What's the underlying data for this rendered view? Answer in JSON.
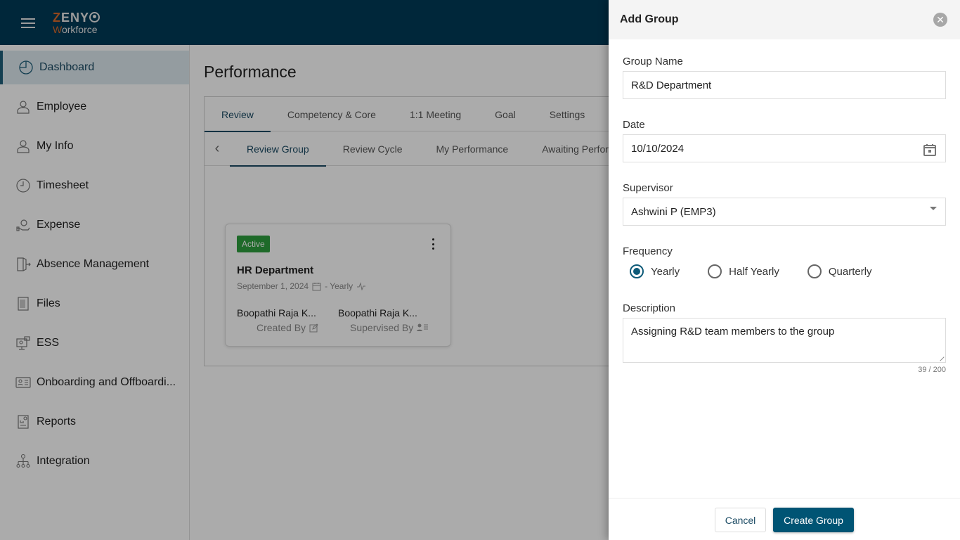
{
  "header": {
    "menu_icon": "hamburger-icon",
    "logo_line1": "ZENY",
    "logo_line2": "Workforce"
  },
  "sidebar": {
    "items": [
      {
        "label": "Dashboard",
        "icon": "pie-chart-icon",
        "active": true
      },
      {
        "label": "Employee",
        "icon": "person-icon"
      },
      {
        "label": "My Info",
        "icon": "person-icon"
      },
      {
        "label": "Timesheet",
        "icon": "clock-icon"
      },
      {
        "label": "Expense",
        "icon": "money-hand-icon"
      },
      {
        "label": "Absence Management",
        "icon": "door-exit-icon"
      },
      {
        "label": "Files",
        "icon": "files-icon"
      },
      {
        "label": "ESS",
        "icon": "monitor-person-icon"
      },
      {
        "label": "Onboarding and Offboardi...",
        "icon": "id-card-icon"
      },
      {
        "label": "Reports",
        "icon": "report-icon"
      },
      {
        "label": "Integration",
        "icon": "hierarchy-icon"
      }
    ]
  },
  "main": {
    "title": "Performance",
    "tabs": [
      {
        "label": "Review",
        "active": true
      },
      {
        "label": "Competency & Core"
      },
      {
        "label": "1:1 Meeting"
      },
      {
        "label": "Goal"
      },
      {
        "label": "Settings"
      }
    ],
    "subtabs": [
      {
        "label": "Review Group",
        "active": true
      },
      {
        "label": "Review Cycle"
      },
      {
        "label": "My Performance"
      },
      {
        "label": "Awaiting Perform"
      }
    ],
    "card": {
      "status": "Active",
      "status_color": "#2e9e3e",
      "title": "HR Department",
      "date": "September 1, 2024",
      "frequency": "- Yearly",
      "created_by_name": "Boopathi Raja K...",
      "created_by_label": "Created By",
      "supervised_by_name": "Boopathi Raja K...",
      "supervised_by_label": "Supervised By"
    }
  },
  "drawer": {
    "title": "Add Group",
    "group_name_label": "Group Name",
    "group_name_value": "R&D Department",
    "date_label": "Date",
    "date_value": "10/10/2024",
    "supervisor_label": "Supervisor",
    "supervisor_value": "Ashwini P (EMP3)",
    "frequency_label": "Frequency",
    "frequency_options": [
      {
        "label": "Yearly",
        "checked": true
      },
      {
        "label": "Half Yearly",
        "checked": false
      },
      {
        "label": "Quarterly",
        "checked": false
      }
    ],
    "description_label": "Description",
    "description_value": "Assigning R&D team members to the group",
    "char_counter": "39 / 200",
    "cancel_label": "Cancel",
    "create_label": "Create Group",
    "accent_color": "#005474"
  }
}
